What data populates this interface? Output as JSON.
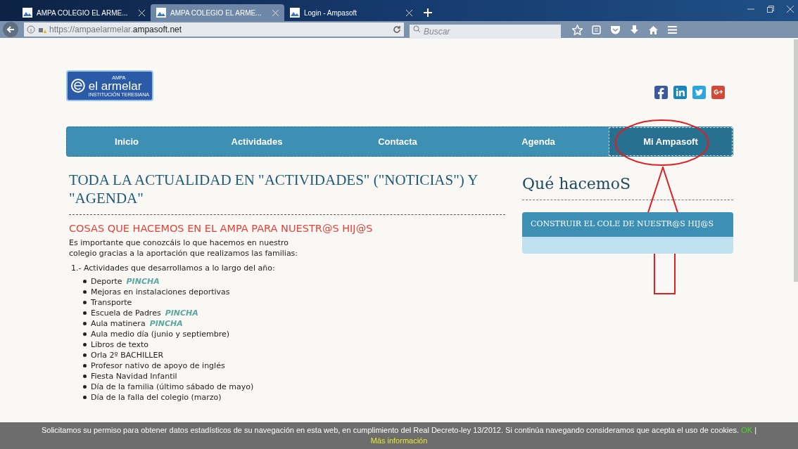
{
  "browser": {
    "tabs": [
      {
        "title": "AMPA COLEGIO EL ARME...",
        "selected": false
      },
      {
        "title": "AMPA COLEGIO EL ARME...",
        "selected": true
      },
      {
        "title": "Login - Ampasoft",
        "selected": false
      }
    ],
    "url_prefix": "https://ampaelarmelar.",
    "url_domain": "ampasoft.net",
    "search_placeholder": "Buscar"
  },
  "header": {
    "logo": {
      "top": "AMPA",
      "name": "el armelar",
      "sub": "INSTITUCIÓN TERESIANA"
    }
  },
  "nav": [
    {
      "label": "Inicio",
      "selected": false
    },
    {
      "label": "Actividades",
      "selected": false
    },
    {
      "label": "Contacta",
      "selected": false
    },
    {
      "label": "Agenda",
      "selected": false
    },
    {
      "label": "Mi Ampasoft",
      "selected": true
    }
  ],
  "main": {
    "title": "TODA LA ACTUALIDAD EN \"ACTIVIDADES\" (\"NOTICIAS\") Y \"AGENDA\"",
    "subtitle": "COSAS QUE HACEMOS EN EL AMPA PARA NUESTR@S HIJ@S",
    "intro": "Es importante que conozcáis lo que hacemos en nuestro colegio gracias a la aportación que realizamos las familias:",
    "section": "1.- Actividades que desarrollamos a lo largo del año:",
    "items": [
      {
        "text": "Deporte",
        "link": "PINCHA"
      },
      {
        "text": "Mejoras en instalaciones deportivas"
      },
      {
        "text": "Transporte"
      },
      {
        "text": "Escuela de Padres",
        "link": "PINCHA"
      },
      {
        "text": "Aula matinera",
        "link": "PINCHA"
      },
      {
        "text": "Aula medio día (junio y septiembre)"
      },
      {
        "text": "Libros de texto"
      },
      {
        "text": "Orla 2º BACHILLER"
      },
      {
        "text": "Profesor nativo de apoyo de inglés"
      },
      {
        "text": "Fiesta Navidad Infantil"
      },
      {
        "text": "Día de la familia (último sábado de mayo)"
      },
      {
        "text": "Día de la falla del colegio (marzo)"
      }
    ]
  },
  "sidebar": {
    "title": "Qué hacemoS",
    "panel_title": "CONSTRUIR EL COLE DE NUESTR@S HIJ@S"
  },
  "cookie_bar": {
    "text": "Solicitamos su permiso para obtener datos estadísticos de su navegación en esta web, en cumplimiento del Real Decreto-ley 13/2012. Si continúa navegando consideramos que acepta el uso de cookies.",
    "ok": "OK",
    "separator": "|",
    "more": "Más información"
  }
}
